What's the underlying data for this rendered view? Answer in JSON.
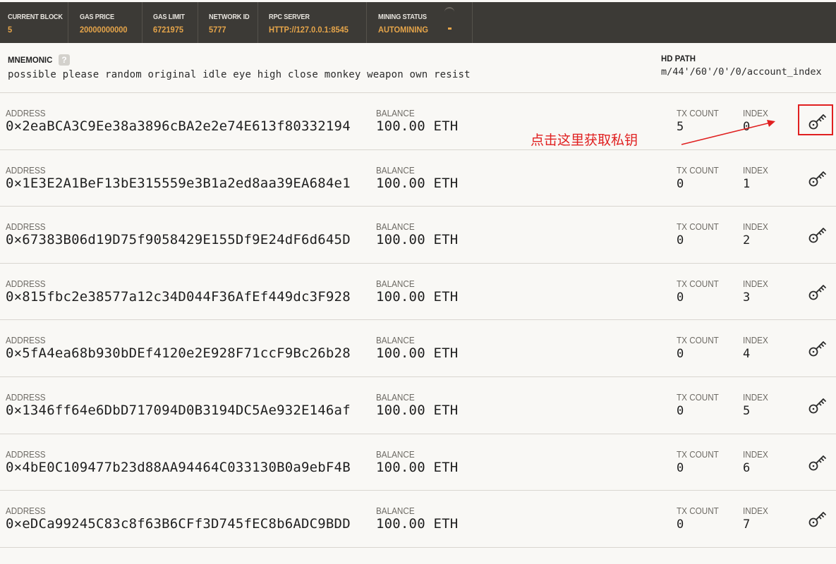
{
  "status_bar": [
    {
      "label": "CURRENT BLOCK",
      "value": "5"
    },
    {
      "label": "GAS PRICE",
      "value": "20000000000"
    },
    {
      "label": "GAS LIMIT",
      "value": "6721975"
    },
    {
      "label": "NETWORK ID",
      "value": "5777"
    },
    {
      "label": "RPC SERVER",
      "value": "HTTP://127.0.0.1:8545"
    },
    {
      "label": "MINING STATUS",
      "value": "AUTOMINING"
    }
  ],
  "mnemonic": {
    "label": "MNEMONIC",
    "help": "?",
    "words": "possible please random original idle eye high close monkey weapon own resist"
  },
  "hd_path": {
    "label": "HD PATH",
    "value": "m/44'/60'/0'/0/account_index"
  },
  "column_labels": {
    "address": "ADDRESS",
    "balance": "BALANCE",
    "tx_count": "TX COUNT",
    "index": "INDEX"
  },
  "accounts": [
    {
      "address": "0×2eaBCA3C9Ee38a3896cBA2e2e74E613f80332194",
      "balance": "100.00 ETH",
      "tx_count": "5",
      "index": "0"
    },
    {
      "address": "0×1E3E2A1BeF13bE315559e3B1a2ed8aa39EA684e1",
      "balance": "100.00 ETH",
      "tx_count": "0",
      "index": "1"
    },
    {
      "address": "0×67383B06d19D75f9058429E155Df9E24dF6d645D",
      "balance": "100.00 ETH",
      "tx_count": "0",
      "index": "2"
    },
    {
      "address": "0×815fbc2e38577a12c34D044F36AfEf449dc3F928",
      "balance": "100.00 ETH",
      "tx_count": "0",
      "index": "3"
    },
    {
      "address": "0×5fA4ea68b930bDEf4120e2E928F71ccF9Bc26b28",
      "balance": "100.00 ETH",
      "tx_count": "0",
      "index": "4"
    },
    {
      "address": "0×1346ff64e6DbD717094D0B3194DC5Ae932E146af",
      "balance": "100.00 ETH",
      "tx_count": "0",
      "index": "5"
    },
    {
      "address": "0×4bE0C109477b23d88AA94464C033130B0a9ebF4B",
      "balance": "100.00 ETH",
      "tx_count": "0",
      "index": "6"
    },
    {
      "address": "0×eDCa99245C83c8f63B6CFf3D745fEC8b6ADC9BDD",
      "balance": "100.00 ETH",
      "tx_count": "0",
      "index": "7"
    }
  ],
  "icons": {
    "key": "key-icon",
    "help": "question-icon",
    "mining": "mining-spinner-icon"
  },
  "annotation": {
    "text": "点击这里获取私钥",
    "color": "#e02020"
  },
  "colors": {
    "statusbar_bg": "#3c3a36",
    "accent": "#e6a54a",
    "page_bg": "#f9f8f5"
  }
}
